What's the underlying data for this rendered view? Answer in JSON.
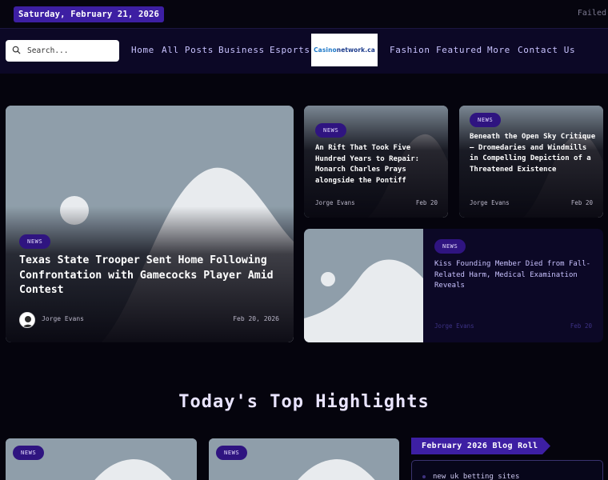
{
  "topbar": {
    "date": "Saturday, February 21, 2026",
    "status": "Failed"
  },
  "nav": {
    "search_placeholder": "Search...",
    "links_left": [
      "Home",
      "All Posts",
      "Business",
      "Esports"
    ],
    "links_right": [
      "Fashion",
      "Featured",
      "More",
      "Contact Us"
    ],
    "logo_prefix": "Casino",
    "logo_suffix": "network.ca"
  },
  "hero": {
    "badge": "NEWS",
    "title": "Texas State Trooper Sent Home Following Confrontation with Gamecocks Player Amid Contest",
    "author": "Jorge Evans",
    "date": "Feb 20, 2026"
  },
  "card_small_1": {
    "badge": "NEWS",
    "title": "An Rift That Took Five Hundred Years to Repair: Monarch Charles Prays alongside the Pontiff",
    "author": "Jorge Evans",
    "date": "Feb 20"
  },
  "card_small_2": {
    "badge": "NEWS",
    "title": "Beneath the Open Sky Critique – Dromedaries and Windmills in Compelling Depiction of a Threatened Existence",
    "author": "Jorge Evans",
    "date": "Feb 20"
  },
  "card_wide": {
    "badge": "NEWS",
    "title": "Kiss Founding Member Died from Fall-Related Harm, Medical Examination Reveals",
    "author": "Jorge Evans",
    "date": "Feb 20"
  },
  "highlights": {
    "title": "Today's Top Highlights",
    "card1_badge": "NEWS",
    "card2_badge": "NEWS",
    "blogroll_title": "February 2026 Blog Roll",
    "blogroll_first": "new uk betting sites"
  },
  "colors": {
    "accent": "#3d1fa3",
    "badge": "#2f1480",
    "nav_bg": "#0c0826",
    "page_bg": "#05040d",
    "placeholder": "#8f9eaa"
  }
}
